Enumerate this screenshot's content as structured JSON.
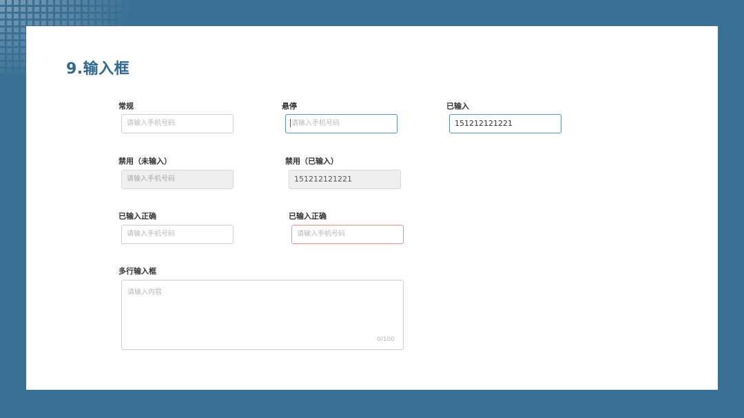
{
  "page": {
    "title": "9.输入框"
  },
  "fields": {
    "normal": {
      "label": "常规",
      "placeholder": "请输入手机号码"
    },
    "hover": {
      "label": "悬停",
      "placeholder": "请输入手机号码"
    },
    "filled": {
      "label": "已输入",
      "value": "151212121221"
    },
    "disabled_empty": {
      "label": "禁用（未输入）",
      "placeholder": "请输入手机号码"
    },
    "disabled_filled": {
      "label": "禁用（已输入）",
      "value": "151212121221"
    },
    "correct": {
      "label": "已输入正确",
      "placeholder": "请输入手机号码"
    },
    "error": {
      "label": "已输入正确",
      "placeholder": "请输入手机号码"
    },
    "multiline": {
      "label": "多行输入框",
      "placeholder": "请输入内容",
      "counter": "0/100"
    }
  },
  "colors": {
    "background": "#3b7095",
    "title": "#2f6790",
    "focus_border": "#5a8fb6",
    "error_border": "#f08a8a",
    "disabled_bg": "#efefef"
  }
}
